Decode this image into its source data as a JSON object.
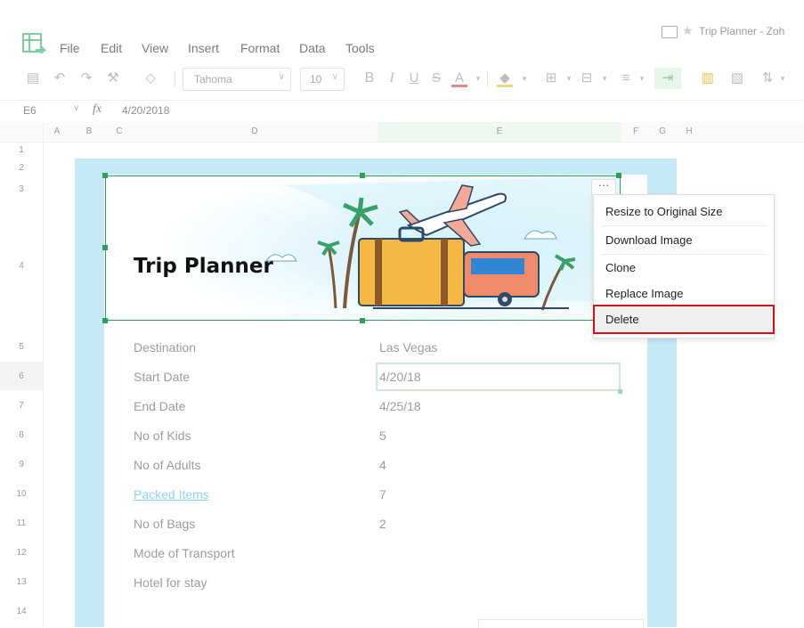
{
  "titlebar": {
    "doc_title": "Trip Planner - Zoh"
  },
  "menu": [
    "File",
    "Edit",
    "View",
    "Insert",
    "Format",
    "Data",
    "Tools"
  ],
  "toolbar": {
    "font_name": "Tahoma",
    "font_size": "10",
    "bold": "B",
    "italic": "I",
    "underline": "U",
    "strike": "S",
    "font_color": "A"
  },
  "formula_bar": {
    "cell_ref": "E6",
    "fx": "fx",
    "value": "4/20/2018"
  },
  "columns": [
    "A",
    "B",
    "C",
    "D",
    "E",
    "F",
    "G",
    "H"
  ],
  "rows": [
    "1",
    "2",
    "3",
    "4",
    "5",
    "6",
    "7",
    "8",
    "9",
    "10",
    "11",
    "12",
    "13",
    "14"
  ],
  "banner": {
    "title": "Trip Planner"
  },
  "sheet": {
    "labels": [
      "Destination",
      "Start Date",
      "End Date",
      "No of Kids",
      "No of Adults",
      "Packed Items",
      "No of Bags",
      "Mode of Transport",
      "Hotel for stay"
    ],
    "values": [
      "Las Vegas",
      "4/20/18",
      "4/25/18",
      "5",
      "4",
      "7",
      "2",
      "",
      ""
    ]
  },
  "context_menu": {
    "more": "···",
    "items": [
      "Resize to Original Size",
      "Download Image",
      "Clone",
      "Replace Image",
      "Delete"
    ]
  },
  "colors": {
    "accent_green": "#2f9e5a",
    "highlight_red": "#d0121a",
    "sheet_bg": "#c6e9f7",
    "link": "#8fd3f0"
  }
}
